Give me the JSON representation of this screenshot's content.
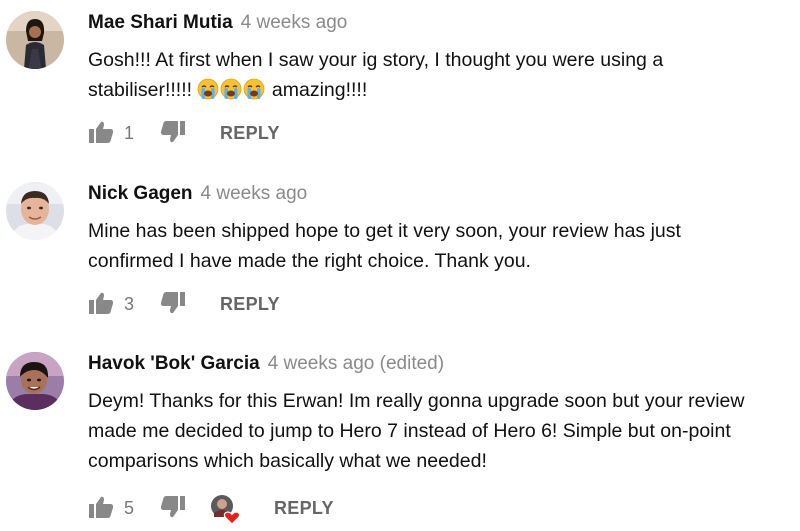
{
  "comments": [
    {
      "author": "Mae Shari Mutia",
      "time": "4 weeks ago",
      "text_line1": "Gosh!!! At first when I saw your ig story, I thought you were using a",
      "text_line2_before": "stabiliser!!!!!",
      "emoji": [
        "loudly-crying-face",
        "loudly-crying-face",
        "loudly-crying-face"
      ],
      "text_line2_after": "amazing!!!!",
      "likes": "1",
      "reply_label": "REPLY"
    },
    {
      "author": "Nick Gagen",
      "time": "4 weeks ago",
      "text_line1": "Mine has been shipped hope to get it very soon, your review has just",
      "text_line2": "confirmed I have made the right choice. Thank you.",
      "likes": "3",
      "reply_label": "REPLY"
    },
    {
      "author": "Havok 'Bok' Garcia",
      "time": "4 weeks ago (edited)",
      "text_line1": "Deym! Thanks for this Erwan! Im really gonna upgrade soon but your review",
      "text_line2": "made me decided to jump to Hero 7 instead of Hero 6! Simple but on-point",
      "text_line3": "comparisons which basically what we needed!",
      "likes": "5",
      "reply_label": "REPLY",
      "creator_heart": true
    }
  ],
  "colors": {
    "text": "#111111",
    "meta": "#8a8a8a",
    "icon": "#888888",
    "heart": "#e62117"
  },
  "icons": {
    "like": "thumbs-up-icon",
    "dislike": "thumbs-down-icon",
    "creator_heart": "creator-heart-icon"
  }
}
